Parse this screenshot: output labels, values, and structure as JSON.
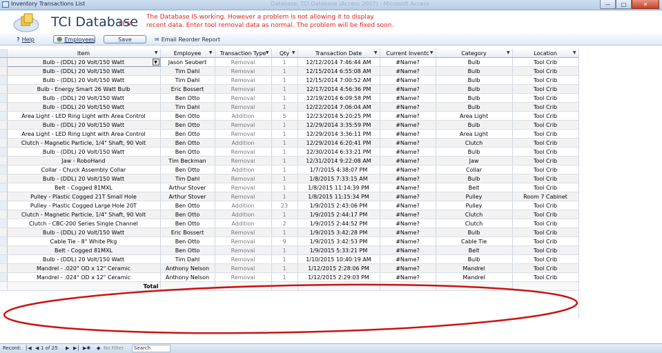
{
  "window": {
    "title": "Inventory Transactions List",
    "center_title": "Database: TCI Database (Access 2007) - Microsoft Access"
  },
  "header": {
    "app_name": "TCI Database",
    "beta": "BETA",
    "notice": "The Database IS working. However a problem is not allowing it to display recent data. Enter tool removal data as normal. The problem will be fixed soon."
  },
  "toolbar": {
    "help": "Help",
    "employees": "Employees",
    "save": "Save",
    "email": "Email Reorder Report"
  },
  "columns": [
    "Item",
    "Employee",
    "Transaction Type",
    "Qty",
    "Transaction Date",
    "Current Inventc",
    "Category",
    "Location"
  ],
  "rows": [
    [
      "Bulb - (DDL) 20 Volt/150 Watt",
      "Jason Seubert",
      "Removal",
      "1",
      "12/12/2014 7:46:44 AM",
      "#Name?",
      "Bulb",
      "Tool Crib"
    ],
    [
      "Bulb - (DDL) 20 Volt/150 Watt",
      "Tim Dahl",
      "Removal",
      "1",
      "12/15/2014 6:55:08 AM",
      "#Name?",
      "Bulb",
      "Tool Crib"
    ],
    [
      "Bulb - (DDL) 20 Volt/150 Watt",
      "Tim Dahl",
      "Removal",
      "1",
      "12/15/2014 7:00:52 AM",
      "#Name?",
      "Bulb",
      "Tool Crib"
    ],
    [
      "Bulb - Energy Smart 26 Watt Bulb",
      "Eric Bossert",
      "Removal",
      "1",
      "12/17/2014 4:56:36 PM",
      "#Name?",
      "Bulb",
      "Tool Crib"
    ],
    [
      "Bulb - (DDL) 20 Volt/150 Watt",
      "Ben Otto",
      "Removal",
      "1",
      "12/19/2014 6:09:58 PM",
      "#Name?",
      "Bulb",
      "Tool Crib"
    ],
    [
      "Bulb - (DDL) 20 Volt/150 Watt",
      "Tim Dahl",
      "Removal",
      "1",
      "12/22/2014 7:06:04 AM",
      "#Name?",
      "Bulb",
      "Tool Crib"
    ],
    [
      "Area Light - LED Ring Light with Area Control",
      "Ben Otto",
      "Addition",
      "5",
      "12/23/2014 5:20:25 PM",
      "#Name?",
      "Area Light",
      "Tool Crib"
    ],
    [
      "Bulb - (DDL) 20 Volt/150 Watt",
      "Ben Otto",
      "Removal",
      "1",
      "12/29/2014 3:35:59 PM",
      "#Name?",
      "Bulb",
      "Tool Crib"
    ],
    [
      "Area Light - LED Ring Light with Area Control",
      "Ben Otto",
      "Removal",
      "1",
      "12/29/2014 3:36:11 PM",
      "#Name?",
      "Area Light",
      "Tool Crib"
    ],
    [
      "Clutch - Magnetic Particle, 1/4\" Shaft, 90 Volt",
      "Ben Otto",
      "Addition",
      "1",
      "12/29/2014 6:20:41 PM",
      "#Name?",
      "Clutch",
      "Tool Crib"
    ],
    [
      "Bulb - (DDL) 20 Volt/150 Watt",
      "Ben Otto",
      "Removal",
      "1",
      "12/30/2014 6:33:21 PM",
      "#Name?",
      "Bulb",
      "Tool Crib"
    ],
    [
      "Jaw - RoboHand",
      "Tim Beckman",
      "Removal",
      "1",
      "12/31/2014 9:22:08 AM",
      "#Name?",
      "Jaw",
      "Tool Crib"
    ],
    [
      "Collar - Chuck Assembly Collar",
      "Ben Otto",
      "Addition",
      "1",
      "1/7/2015 4:38:07 PM",
      "#Name?",
      "Collar",
      "Tool Crib"
    ],
    [
      "Bulb - (DDL) 20 Volt/150 Watt",
      "Tim Dahl",
      "Removal",
      "1",
      "1/8/2015 7:33:15 AM",
      "#Name?",
      "Bulb",
      "Tool Crib"
    ],
    [
      "Belt - Cogged 81MXL",
      "Arthur Stover",
      "Removal",
      "1",
      "1/8/2015 11:14:39 PM",
      "#Name?",
      "Belt",
      "Tool Crib"
    ],
    [
      "Pulley - Plastic Cogged 21T Small Hole",
      "Arthur Stover",
      "Removal",
      "1",
      "1/8/2015 11:15:34 PM",
      "#Name?",
      "Pulley",
      "Room 7 Cabinet"
    ],
    [
      "Pulley - Plastic Cogged Large Hole 20T",
      "Ben Otto",
      "Addition",
      "23",
      "1/9/2015 2:43:06 PM",
      "#Name?",
      "Pulley",
      "Tool Crib"
    ],
    [
      "Clutch - Magnetic Particle, 1/4\" Shaft, 90 Volt",
      "Ben Otto",
      "Addition",
      "1",
      "1/9/2015 2:44:17 PM",
      "#Name?",
      "Clutch",
      "Tool Crib"
    ],
    [
      "Clutch - CBC-200 Series Single Channel",
      "Ben Otto",
      "Addition",
      "2",
      "1/9/2015 2:44:52 PM",
      "#Name?",
      "Clutch",
      "Tool Crib"
    ],
    [
      "Bulb - (DDL) 20 Volt/150 Watt",
      "Eric Bossert",
      "Removal",
      "1",
      "1/9/2015 3:42:28 PM",
      "#Name?",
      "Bulb",
      "Tool Crib"
    ],
    [
      "Cable Tie - 8\"  White Pkg",
      "Ben Otto",
      "Removal",
      "9",
      "1/9/2015 3:42:53 PM",
      "#Name?",
      "Cable Tie",
      "Tool Crib"
    ],
    [
      "Belt - Cogged 81MXL",
      "Ben Otto",
      "Removal",
      "1",
      "1/9/2015 5:33:21 PM",
      "#Name?",
      "Belt",
      "Tool Crib"
    ],
    [
      "Bulb - (DDL) 20 Volt/150 Watt",
      "Tim Dahl",
      "Removal",
      "1",
      "1/10/2015 10:40:19 AM",
      "#Name?",
      "Bulb",
      "Tool Crib"
    ],
    [
      "Mandrel - .020\" OD x 12\" Ceramic",
      "Anthony Nelson",
      "Removal",
      "1",
      "1/12/2015 2:28:06 PM",
      "#Name?",
      "Mandrel",
      "Tool Crib"
    ],
    [
      "Mandrel - .024\" OD x 12\" Ceramic",
      "Anthony Nelson",
      "Removal",
      "1",
      "1/12/2015 2:29:03 PM",
      "#Name?",
      "Mandrel",
      "Tool Crib"
    ]
  ],
  "total_label": "Total",
  "status": {
    "record_label": "Record:",
    "record_pos": "1 of 25",
    "filter": "No Filter",
    "search": "Search"
  },
  "colors": {
    "annotation": "#cc1111",
    "notice": "#e02020"
  }
}
